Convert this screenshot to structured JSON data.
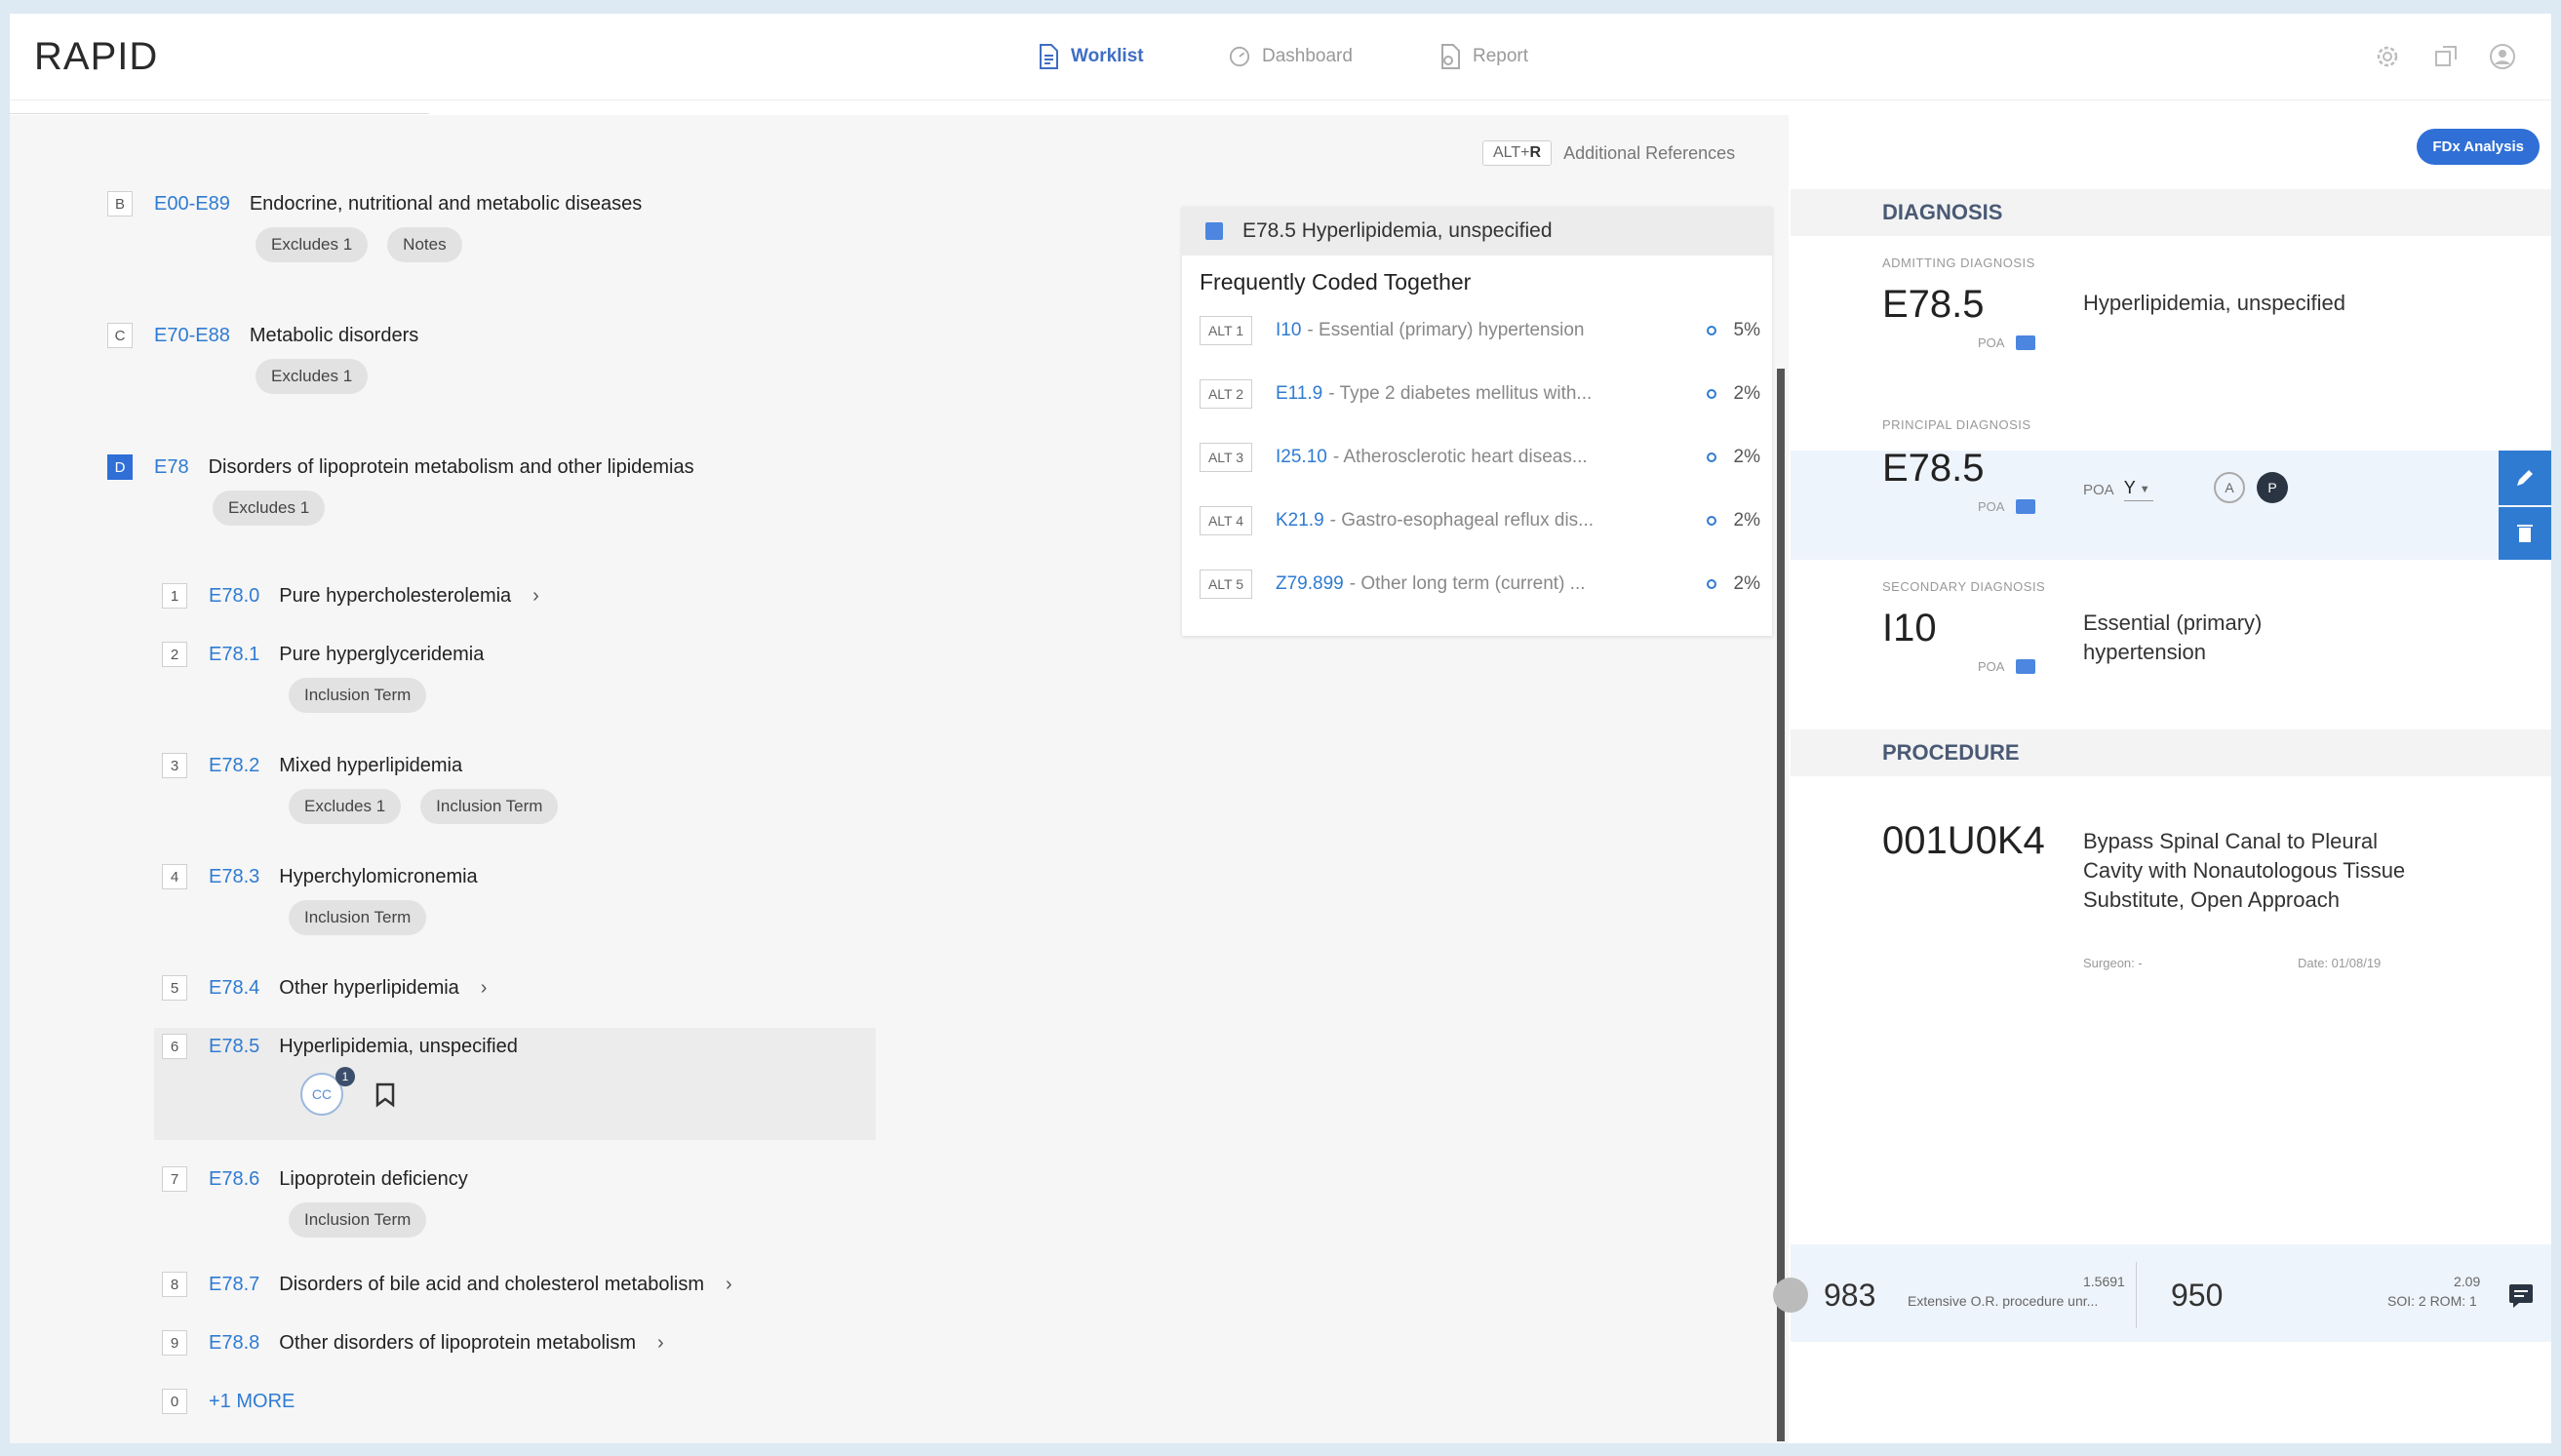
{
  "app": {
    "logo": "RAPID"
  },
  "nav": [
    {
      "label": "Worklist",
      "icon": "document-icon",
      "active": true
    },
    {
      "label": "Dashboard",
      "icon": "dashboard-icon",
      "active": false
    },
    {
      "label": "Report",
      "icon": "report-icon",
      "active": false
    }
  ],
  "toolbar": {
    "shortcut_prefix": "ALT+",
    "shortcut_key": "R",
    "additional_references": "Additional References"
  },
  "hierarchy": [
    {
      "badge": "B",
      "code": "E00-E89",
      "label": "Endocrine, nutritional and metabolic diseases",
      "chips": [
        "Excludes 1",
        "Notes"
      ]
    },
    {
      "badge": "C",
      "code": "E70-E88",
      "label": "Metabolic disorders",
      "chips": [
        "Excludes 1"
      ]
    },
    {
      "badge": "D",
      "code": "E78",
      "label": "Disorders of lipoprotein metabolism and other lipidemias",
      "chips": [
        "Excludes 1"
      ]
    }
  ],
  "codes": [
    {
      "num": "1",
      "code": "E78.0",
      "label": "Pure hypercholesterolemia",
      "chips": [],
      "expand": true
    },
    {
      "num": "2",
      "code": "E78.1",
      "label": "Pure hyperglyceridemia",
      "chips": [
        "Inclusion Term"
      ],
      "expand": false
    },
    {
      "num": "3",
      "code": "E78.2",
      "label": "Mixed hyperlipidemia",
      "chips": [
        "Excludes 1",
        "Inclusion Term"
      ],
      "expand": false
    },
    {
      "num": "4",
      "code": "E78.3",
      "label": "Hyperchylomicronemia",
      "chips": [
        "Inclusion Term"
      ],
      "expand": false
    },
    {
      "num": "5",
      "code": "E78.4",
      "label": "Other hyperlipidemia",
      "chips": [],
      "expand": true
    },
    {
      "num": "6",
      "code": "E78.5",
      "label": "Hyperlipidemia, unspecified",
      "chips": [],
      "expand": false,
      "cc": "CC",
      "cc_count": "1"
    },
    {
      "num": "7",
      "code": "E78.6",
      "label": "Lipoprotein deficiency",
      "chips": [
        "Inclusion Term"
      ],
      "expand": false
    },
    {
      "num": "8",
      "code": "E78.7",
      "label": "Disorders of bile acid and cholesterol metabolism",
      "chips": [],
      "expand": true
    },
    {
      "num": "9",
      "code": "E78.8",
      "label": "Other disorders of lipoprotein metabolism",
      "chips": [],
      "expand": true
    }
  ],
  "more": {
    "num": "0",
    "label": "+1 MORE"
  },
  "freq_card": {
    "header": "E78.5 Hyperlipidemia, unspecified",
    "title": "Frequently Coded Together",
    "rows": [
      {
        "alt": "ALT 1",
        "code": "I10",
        "desc": " - Essential (primary) hypertension",
        "pct": "5%"
      },
      {
        "alt": "ALT 2",
        "code": "E11.9",
        "desc": " - Type 2 diabetes mellitus with...",
        "pct": "2%"
      },
      {
        "alt": "ALT 3",
        "code": "I25.10",
        "desc": " - Atherosclerotic heart diseas...",
        "pct": "2%"
      },
      {
        "alt": "ALT 4",
        "code": "K21.9",
        "desc": " - Gastro-esophageal reflux dis...",
        "pct": "2%"
      },
      {
        "alt": "ALT 5",
        "code": "Z79.899",
        "desc": " - Other long term (current) ...",
        "pct": "2%"
      }
    ]
  },
  "right": {
    "fdx_button": "FDx Analysis",
    "diagnosis_title": "DIAGNOSIS",
    "admitting": {
      "label": "ADMITTING DIAGNOSIS",
      "code": "E78.5",
      "poa": "POA",
      "desc": "Hyperlipidemia, unspecified"
    },
    "principal": {
      "label": "PRINCIPAL DIAGNOSIS",
      "code": "E78.5",
      "poa": "POA",
      "poa_select_label": "POA",
      "poa_select_value": "Y",
      "a": "A",
      "p": "P"
    },
    "secondary": {
      "label": "SECONDARY DIAGNOSIS",
      "code": "I10",
      "poa": "POA",
      "desc": "Essential (primary) hypertension"
    },
    "procedure_title": "PROCEDURE",
    "procedure": {
      "code": "001U0K4",
      "desc": "Bypass Spinal Canal to Pleural Cavity with Nonautologous Tissue Substitute, Open Approach",
      "surgeon": "Surgeon: -",
      "date": "Date: 01/08/19"
    }
  },
  "bottom": {
    "drg1": "983",
    "drg1_desc": "Extensive O.R. procedure unr...",
    "drg1_weight": "1.5691",
    "drg2": "950",
    "drg2_weight": "2.09",
    "drg2_desc": "SOI: 2 ROM: 1"
  },
  "colors": {
    "accent": "#2f7bd2",
    "active_badge": "#2f6fd6"
  }
}
